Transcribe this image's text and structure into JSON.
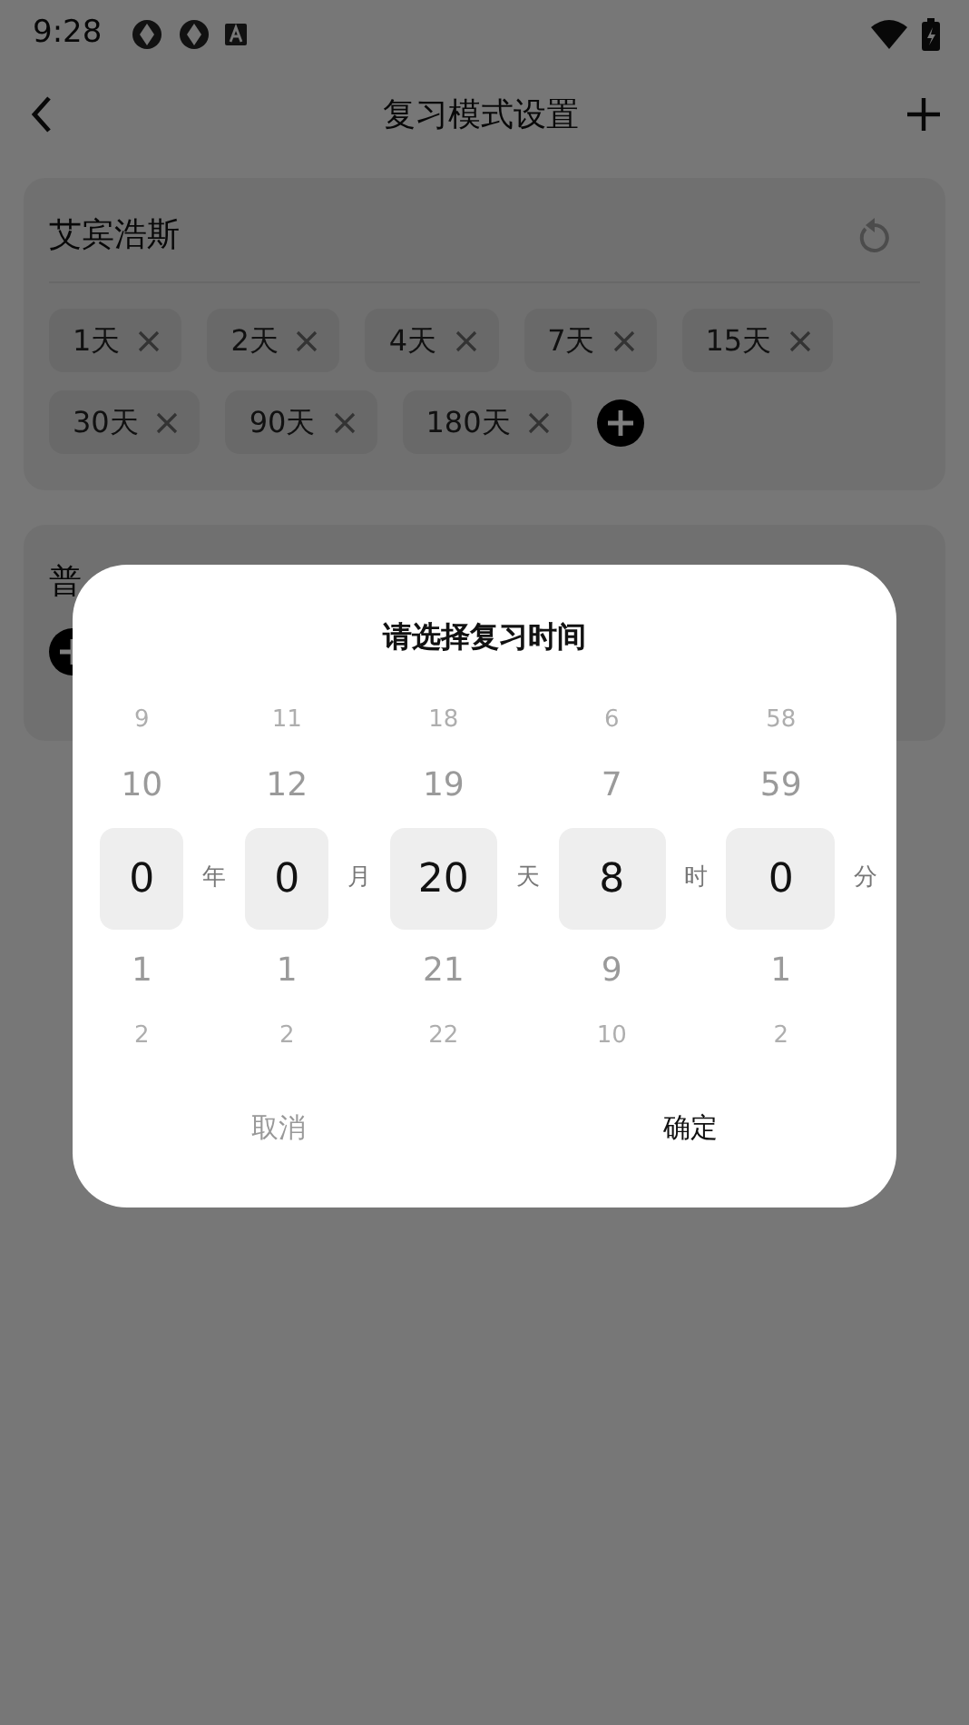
{
  "status_bar": {
    "time": "9:28"
  },
  "header": {
    "title": "复习模式设置"
  },
  "cards": [
    {
      "title": "艾宾浩斯",
      "chips": [
        {
          "label": "1天"
        },
        {
          "label": "2天"
        },
        {
          "label": "4天"
        },
        {
          "label": "7天"
        },
        {
          "label": "15天"
        },
        {
          "label": "30天"
        },
        {
          "label": "90天"
        },
        {
          "label": "180天"
        }
      ]
    },
    {
      "title": "普"
    }
  ],
  "dialog": {
    "title": "请选择复习时间",
    "columns": [
      {
        "unit": "年",
        "items": [
          {
            "text": "9",
            "selected": false
          },
          {
            "text": "10",
            "selected": false
          },
          {
            "text": "0",
            "selected": true
          },
          {
            "text": "1",
            "selected": false
          },
          {
            "text": "2",
            "selected": false
          }
        ]
      },
      {
        "unit": "月",
        "items": [
          {
            "text": "11",
            "selected": false
          },
          {
            "text": "12",
            "selected": false
          },
          {
            "text": "0",
            "selected": true
          },
          {
            "text": "1",
            "selected": false
          },
          {
            "text": "2",
            "selected": false
          }
        ]
      },
      {
        "unit": "天",
        "items": [
          {
            "text": "18",
            "selected": false
          },
          {
            "text": "19",
            "selected": false
          },
          {
            "text": "20",
            "selected": true
          },
          {
            "text": "21",
            "selected": false
          },
          {
            "text": "22",
            "selected": false
          }
        ]
      },
      {
        "unit": "时",
        "items": [
          {
            "text": "6",
            "selected": false
          },
          {
            "text": "7",
            "selected": false
          },
          {
            "text": "8",
            "selected": true
          },
          {
            "text": "9",
            "selected": false
          },
          {
            "text": "10",
            "selected": false
          }
        ]
      },
      {
        "unit": "分",
        "items": [
          {
            "text": "58",
            "selected": false
          },
          {
            "text": "59",
            "selected": false
          },
          {
            "text": "0",
            "selected": true
          },
          {
            "text": "1",
            "selected": false
          },
          {
            "text": "2",
            "selected": false
          }
        ]
      }
    ],
    "buttons": [
      {
        "label": "取消",
        "kind": "cancel"
      },
      {
        "label": "确定",
        "kind": "confirm"
      }
    ]
  }
}
